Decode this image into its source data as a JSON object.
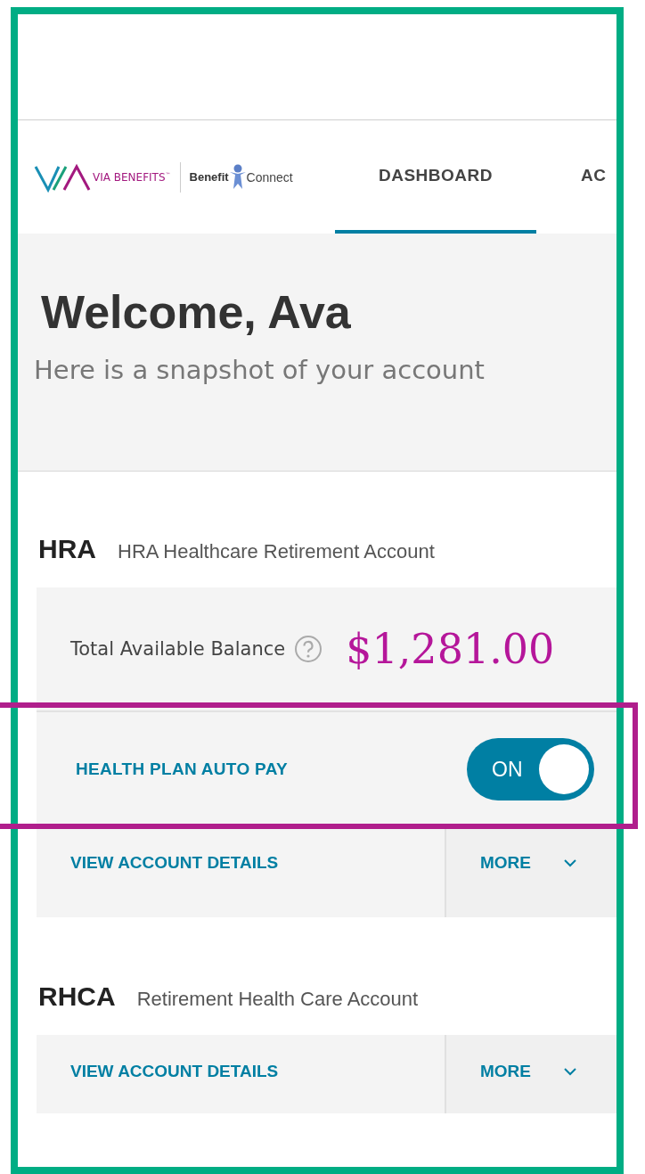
{
  "header": {
    "logo": {
      "brand": "VIA BENEFITS",
      "trademark": "™",
      "partner_bold": "Benefit",
      "partner": "Connect"
    },
    "tabs": [
      {
        "label": "DASHBOARD",
        "selected": true
      },
      {
        "label": "AC",
        "selected": false
      }
    ]
  },
  "welcome": {
    "title": "Welcome, Ava",
    "subtitle": "Here is a snapshot of your account"
  },
  "accounts": [
    {
      "code": "HRA",
      "name": "HRA Healthcare Retirement Account",
      "balance": {
        "label": "Total Available Balance",
        "amount": "$1,281.00"
      },
      "auto_pay": {
        "label": "HEALTH PLAN AUTO PAY",
        "on": true,
        "state_label": "ON"
      },
      "details_link": "VIEW ACCOUNT DETAILS",
      "more": "MORE"
    },
    {
      "code": "RHCA",
      "name": "Retirement Health Care Account",
      "details_link": "VIEW ACCOUNT DETAILS",
      "more": "MORE"
    }
  ]
}
